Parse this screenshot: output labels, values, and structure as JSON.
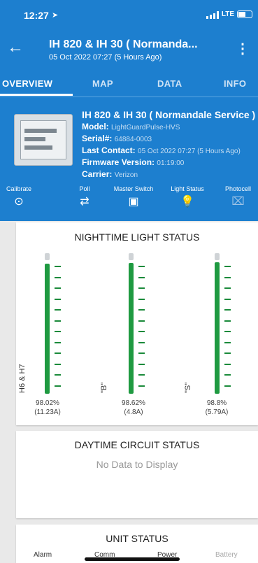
{
  "status_bar": {
    "time": "12:27",
    "network": "LTE"
  },
  "header": {
    "title": "IH 820 & IH 30 ( Normanda...",
    "subtitle": "05 Oct 2022 07:27 (5 Hours Ago)",
    "back_icon": "arrow-left-icon",
    "menu_icon": "kebab-menu-icon"
  },
  "tabs": [
    {
      "label": "OVERVIEW",
      "active": true
    },
    {
      "label": "MAP",
      "active": false
    },
    {
      "label": "DATA",
      "active": false
    },
    {
      "label": "INFO",
      "active": false
    }
  ],
  "device": {
    "name": "IH 820 & IH 30 ( Normandale Service )",
    "model_label": "Model:",
    "model": "LightGuardPulse-HVS",
    "serial_label": "Serial#:",
    "serial": "64884-0003",
    "last_contact_label": "Last Contact:",
    "last_contact": "05 Oct 2022 07:27 (5 Hours Ago)",
    "firmware_label": "Firmware Version:",
    "firmware": "01:19:00",
    "carrier_label": "Carrier:",
    "carrier": "Verizon"
  },
  "quick_actions": [
    {
      "label": "Calibrate",
      "icon": "target-icon"
    },
    {
      "label": "Poll",
      "icon": "repeat-icon"
    },
    {
      "label": "Master Switch",
      "icon": "switch-icon"
    },
    {
      "label": "Light Status",
      "icon": "lightbulb-icon"
    },
    {
      "label": "Photocell",
      "icon": "photocell-icon"
    }
  ],
  "nighttime": {
    "title": "NIGHTTIME LIGHT STATUS",
    "circuits": [
      {
        "label": "H6 & H7",
        "percent": "98.02%",
        "amps": "(11.23A)",
        "level": 0.98
      },
      {
        "label": "\"B\"",
        "percent": "98.62%",
        "amps": "(4.8A)",
        "level": 0.986
      },
      {
        "label": "\"S\"",
        "percent": "98.8%",
        "amps": "(5.79A)",
        "level": 0.988
      }
    ]
  },
  "daytime": {
    "title": "DAYTIME CIRCUIT STATUS",
    "empty_text": "No Data to Display"
  },
  "unit_status": {
    "title": "UNIT STATUS",
    "items": [
      "Alarm",
      "Comm",
      "Power",
      "Battery"
    ]
  },
  "colors": {
    "primary": "#1d7fcf",
    "level_bar": "#1f9a41"
  }
}
